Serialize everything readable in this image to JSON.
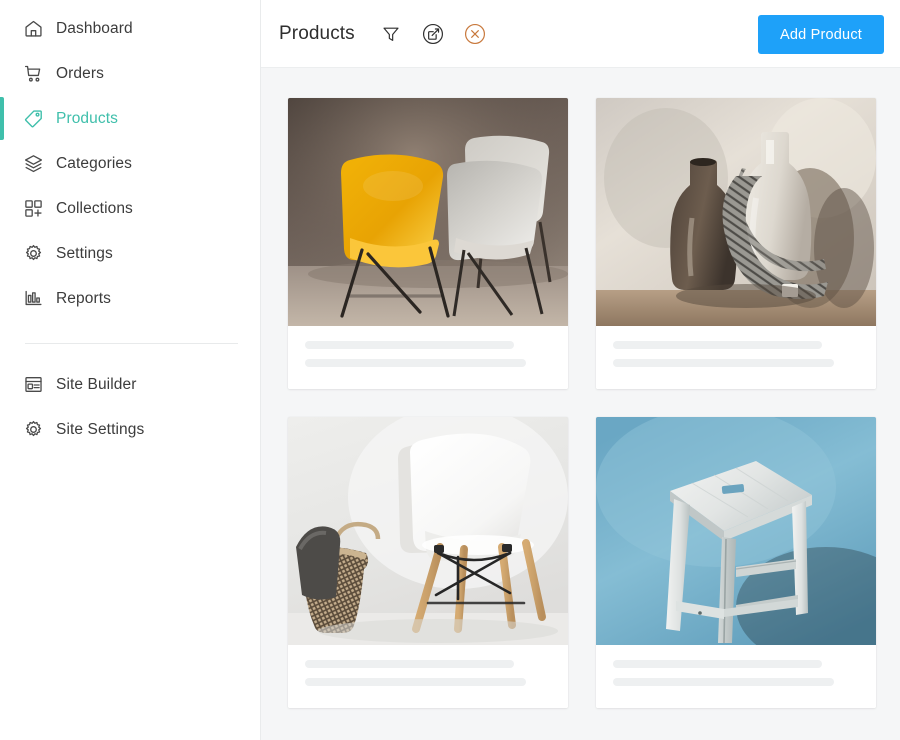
{
  "sidebar": {
    "primary_items": [
      {
        "label": "Dashboard",
        "icon": "home-icon",
        "active": false
      },
      {
        "label": "Orders",
        "icon": "cart-icon",
        "active": false
      },
      {
        "label": "Products",
        "icon": "tag-icon",
        "active": true
      },
      {
        "label": "Categories",
        "icon": "layers-icon",
        "active": false
      },
      {
        "label": "Collections",
        "icon": "grid-plus-icon",
        "active": false
      },
      {
        "label": "Settings",
        "icon": "gear-icon",
        "active": false
      },
      {
        "label": "Reports",
        "icon": "bar-chart-icon",
        "active": false
      }
    ],
    "secondary_items": [
      {
        "label": "Site Builder",
        "icon": "layout-icon",
        "active": false
      },
      {
        "label": "Site Settings",
        "icon": "gear-icon",
        "active": false
      }
    ],
    "active_color": "#3fbfab"
  },
  "header": {
    "title": "Products",
    "actions": [
      {
        "name": "filter-icon",
        "label": "Filter",
        "color": "#2f2f2f"
      },
      {
        "name": "bulk-edit-icon",
        "label": "Bulk Edit",
        "color": "#2f2f2f"
      },
      {
        "name": "clear-icon",
        "label": "Clear",
        "color": "#c8783c"
      }
    ],
    "add_button_label": "Add Product",
    "add_button_color": "#1ea1f9"
  },
  "products": [
    {
      "image_name": "yellow-and-white-chairs-photo",
      "placeholder_line_widths": [
        "85%",
        "90%"
      ]
    },
    {
      "image_name": "ceramic-bottles-and-scarf-photo",
      "placeholder_line_widths": [
        "85%",
        "90%"
      ]
    },
    {
      "image_name": "white-eames-chair-with-basket-photo",
      "placeholder_line_widths": [
        "85%",
        "90%"
      ]
    },
    {
      "image_name": "white-wooden-stool-on-blue-photo",
      "placeholder_line_widths": [
        "85%",
        "90%"
      ]
    }
  ],
  "colors": {
    "page_background": "#f5f6f7",
    "card_background": "#ffffff",
    "placeholder_bar": "#eef0f1",
    "sidebar_border": "#e9ebec",
    "text_primary": "#3c3c3c"
  }
}
